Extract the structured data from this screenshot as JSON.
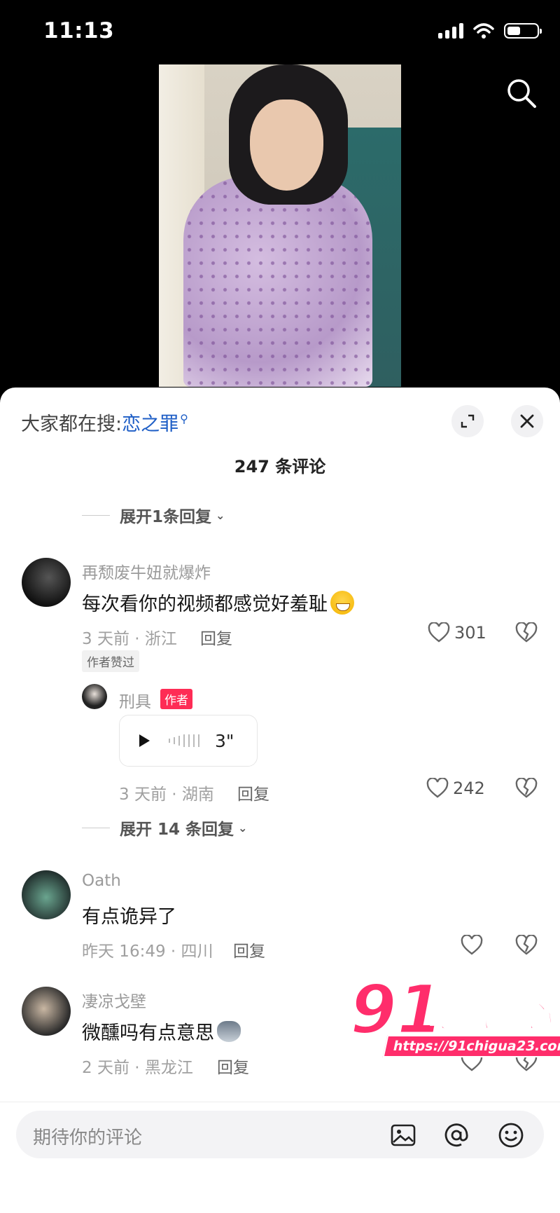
{
  "status_bar": {
    "time": "11:13"
  },
  "sheet": {
    "hot_search_label": "大家都在搜:",
    "hot_search_term": "恋之罪",
    "comment_count": "247 条评论",
    "expand_top": "展开1条回复"
  },
  "comments": [
    {
      "username": "再颓废牛妞就爆炸",
      "text": "每次看你的视频都感觉好羞耻",
      "meta": "3 天前 · 浙江",
      "reply_label": "回复",
      "likes": "301",
      "author_liked": "作者赞过",
      "reply": {
        "username": "刑具",
        "badge": "作者",
        "voice_duration": "3\"",
        "meta": "3 天前 · 湖南",
        "reply_label": "回复",
        "likes": "242"
      },
      "expand_more": "展开 14 条回复"
    },
    {
      "username": "Oath",
      "text": "有点诡异了",
      "meta": "昨天 16:49 · 四川",
      "reply_label": "回复"
    },
    {
      "username": "凄凉戈壁",
      "text": "微醺吗有点意思",
      "meta": "2 天前 · 黑龙江",
      "reply_label": "回复"
    }
  ],
  "input": {
    "placeholder": "期待你的评论"
  },
  "watermark": {
    "brand_number": "91",
    "brand_name": "吃瓜中心",
    "url": "https://91chigua23.com"
  },
  "icons": [
    "search-icon",
    "expand-icon",
    "close-icon",
    "heart-icon",
    "broken-heart-icon",
    "play-icon",
    "image-icon",
    "at-icon",
    "emoji-icon"
  ]
}
